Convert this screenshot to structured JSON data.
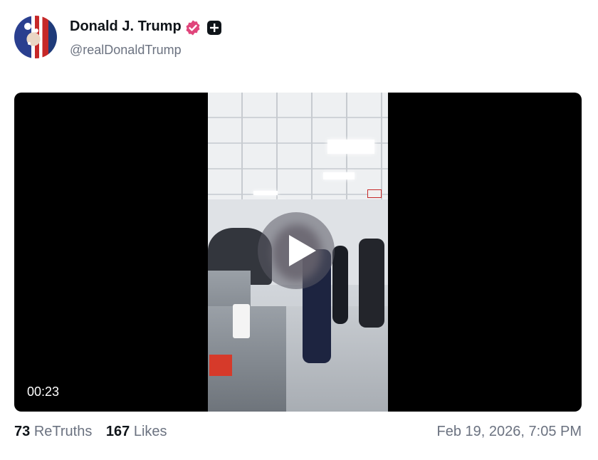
{
  "author": {
    "name": "Donald J. Trump",
    "handle": "@realDonaldTrump"
  },
  "video": {
    "duration": "00:23"
  },
  "stats": {
    "retruths_count": "73",
    "retruths_label": "ReTruths",
    "likes_count": "167",
    "likes_label": "Likes"
  },
  "timestamp": "Feb 19, 2026, 7:05 PM",
  "icons": {
    "verified": "verified-badge-icon",
    "plus": "plus-badge-icon",
    "play": "play-icon"
  },
  "colors": {
    "verified_badge": "#e0457b",
    "text_primary": "#0f1419",
    "text_muted": "#6b7280",
    "video_bg": "#000000"
  }
}
